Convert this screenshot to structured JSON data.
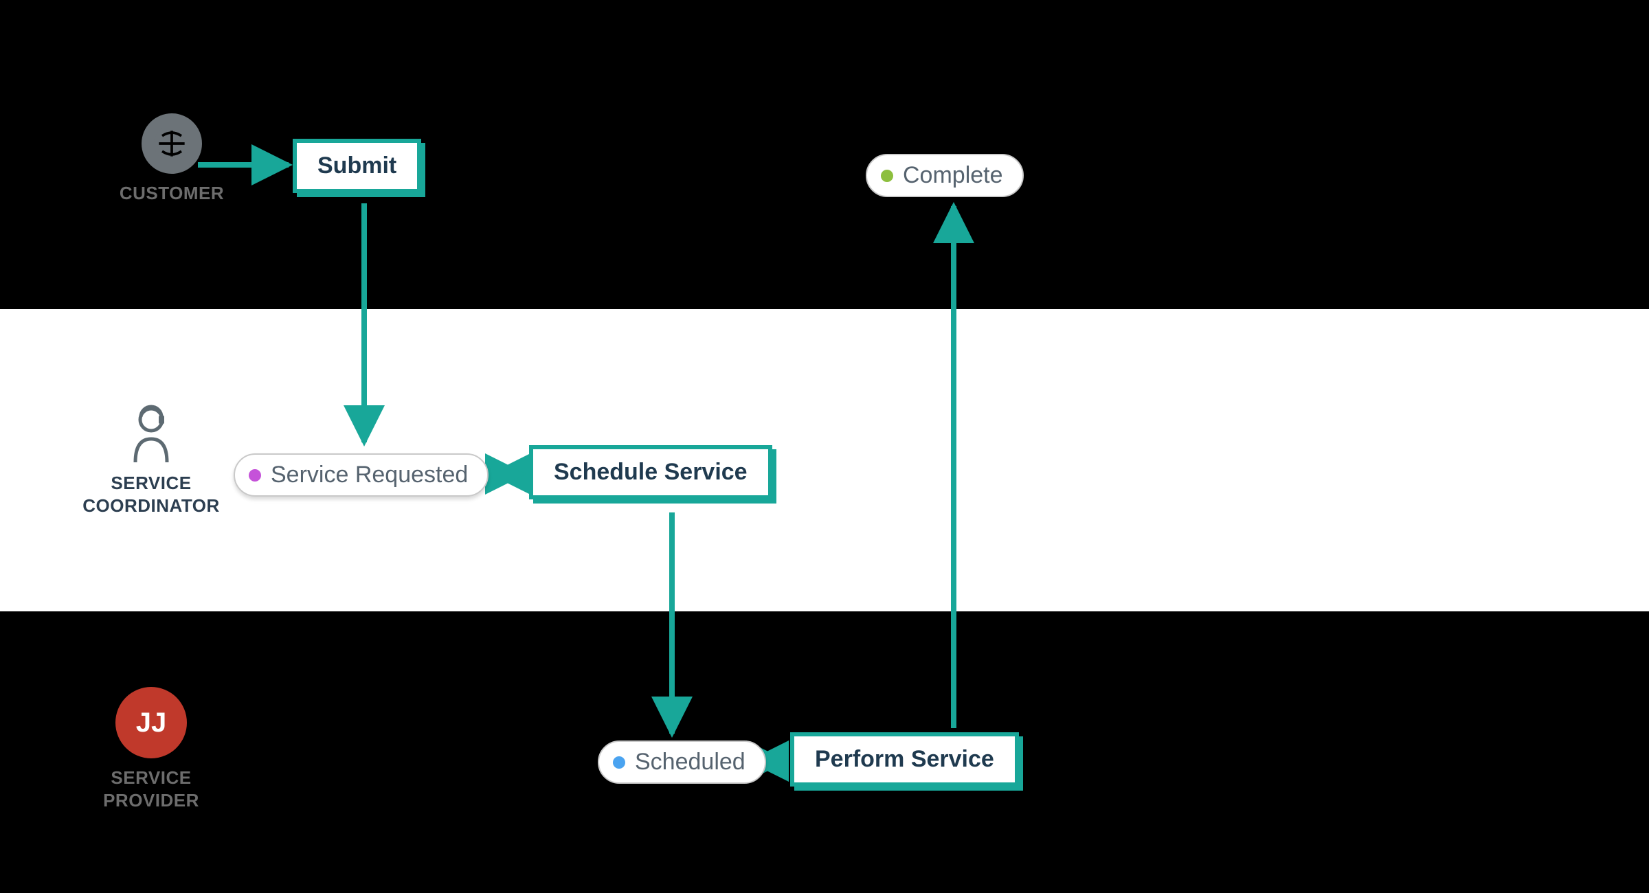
{
  "actors": {
    "customer": {
      "label": "CUSTOMER"
    },
    "coordinator": {
      "label": "SERVICE\nCOORDINATOR"
    },
    "provider": {
      "label": "SERVICE\nPROVIDER",
      "initials": "JJ"
    }
  },
  "nodes": {
    "submit": {
      "label": "Submit",
      "type": "action"
    },
    "service_requested": {
      "label": "Service Requested",
      "type": "state",
      "dot": "purple"
    },
    "schedule_service": {
      "label": "Schedule Service",
      "type": "action"
    },
    "scheduled": {
      "label": "Scheduled",
      "type": "state",
      "dot": "blue"
    },
    "perform_service": {
      "label": "Perform Service",
      "type": "action"
    },
    "complete": {
      "label": "Complete",
      "type": "state",
      "dot": "green"
    }
  },
  "edges": [
    {
      "from": "customer-icon",
      "to": "submit"
    },
    {
      "from": "submit",
      "to": "service_requested"
    },
    {
      "from": "service_requested",
      "to": "schedule_service"
    },
    {
      "from": "schedule_service",
      "to": "scheduled"
    },
    {
      "from": "scheduled",
      "to": "perform_service"
    },
    {
      "from": "perform_service",
      "to": "complete"
    }
  ],
  "colors": {
    "accent": "#18a799"
  }
}
